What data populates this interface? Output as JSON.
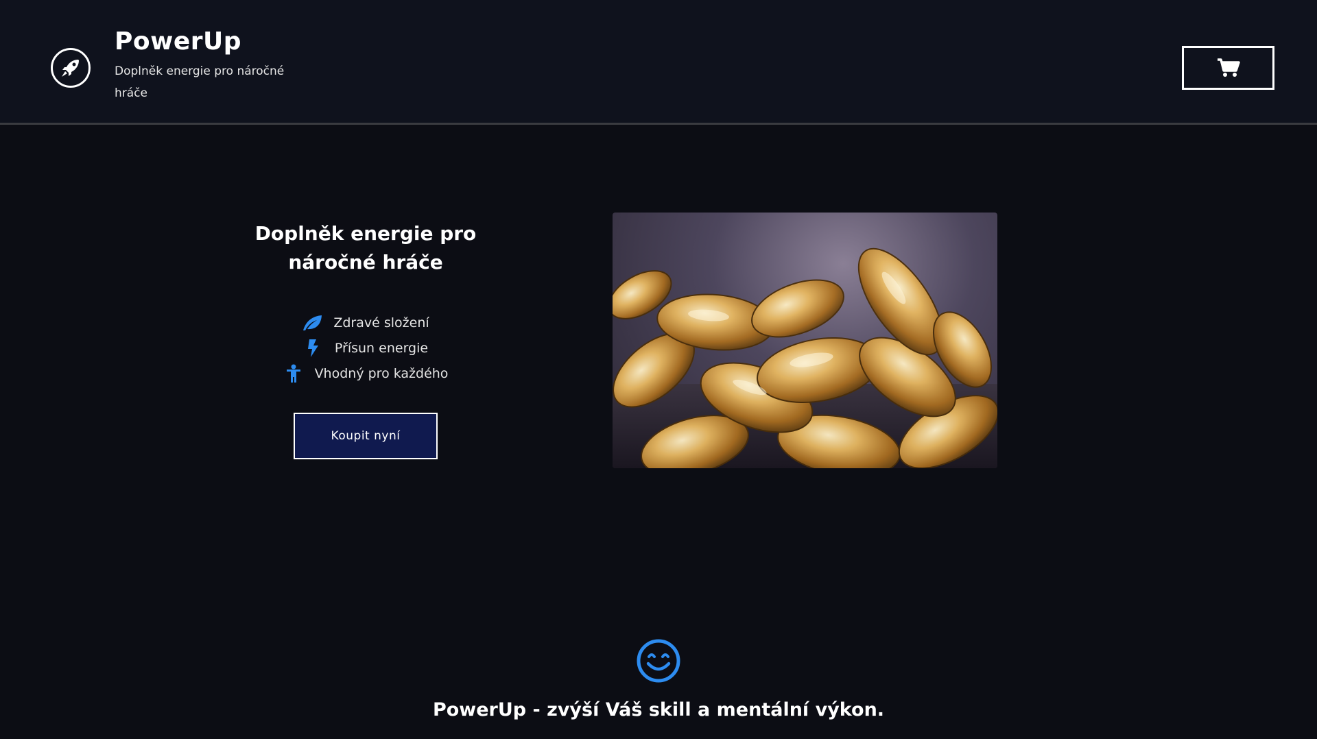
{
  "header": {
    "brand": "PowerUp",
    "subtitle": "Doplněk energie pro náročné hráče",
    "logo_icon": "rocket-icon",
    "cart_icon": "shopping-cart-icon"
  },
  "hero": {
    "title": "Doplněk energie pro náročné hráče",
    "features": [
      {
        "icon": "leaf-icon",
        "label": "Zdravé složení"
      },
      {
        "icon": "bolt-icon",
        "label": "Přísun energie"
      },
      {
        "icon": "person-icon",
        "label": "Vhodný pro každého"
      }
    ],
    "buy_label": "Koupit nyní",
    "image_subject": "golden supplement capsules"
  },
  "footer": {
    "icon": "smile-icon",
    "tagline": "PowerUp - zvýší Váš skill a mentální výkon."
  },
  "colors": {
    "background": "#0c0d14",
    "header_bg": "#0f121d",
    "accent_blue": "#2d8cf0",
    "button_bg": "#101a4f"
  }
}
